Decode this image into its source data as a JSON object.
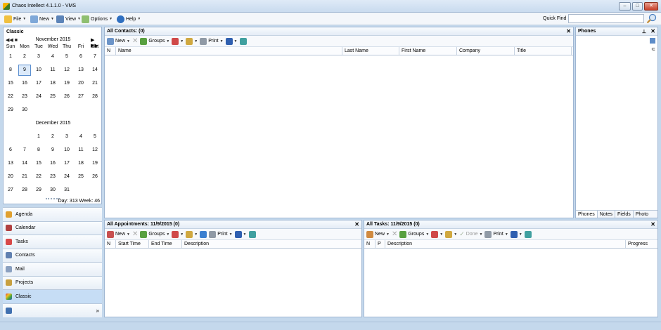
{
  "app_title": "Chaos Intellect 4.1.1.0 - VMS",
  "menu": {
    "file": "File",
    "new": "New",
    "view": "View",
    "options": "Options",
    "help": "Help"
  },
  "quick_find": "Quick Find",
  "calendar": {
    "title": "Classic",
    "weekdays": [
      "Sun",
      "Mon",
      "Tue",
      "Wed",
      "Thu",
      "Fri",
      "Sat"
    ],
    "month1": "November 2015",
    "month1_weeks": [
      [
        "1",
        "2",
        "3",
        "4",
        "5",
        "6",
        "7"
      ],
      [
        "8",
        "9",
        "10",
        "11",
        "12",
        "13",
        "14"
      ],
      [
        "15",
        "16",
        "17",
        "18",
        "19",
        "20",
        "21"
      ],
      [
        "22",
        "23",
        "24",
        "25",
        "26",
        "27",
        "28"
      ],
      [
        "29",
        "30",
        "",
        "",
        "",
        "",
        ""
      ]
    ],
    "month2": "December 2015",
    "month2_weeks": [
      [
        "",
        "",
        "1",
        "2",
        "3",
        "4",
        "5"
      ],
      [
        "6",
        "7",
        "8",
        "9",
        "10",
        "11",
        "12"
      ],
      [
        "13",
        "14",
        "15",
        "16",
        "17",
        "18",
        "19"
      ],
      [
        "20",
        "21",
        "22",
        "23",
        "24",
        "25",
        "26"
      ],
      [
        "27",
        "28",
        "29",
        "30",
        "31",
        "",
        ""
      ]
    ],
    "selected_day": "9",
    "day_info": "Day: 313  Week: 46"
  },
  "nav": [
    "Agenda",
    "Calendar",
    "Tasks",
    "Contacts",
    "Mail",
    "Projects",
    "Classic"
  ],
  "contacts": {
    "title": "All Contacts: (0)",
    "columns": [
      "N",
      "Name",
      "Last Name",
      "First Name",
      "Company",
      "Title"
    ]
  },
  "phones": {
    "title": "Phones",
    "tabs": [
      "Phones",
      "Notes",
      "Fields",
      "Photo"
    ]
  },
  "appointments": {
    "title": "All Appointments: 11/9/2015  (0)",
    "columns": [
      "N",
      "Start Time",
      "End Time",
      "Description"
    ]
  },
  "tasks": {
    "title": "All Tasks: 11/9/2015  (0)",
    "columns": [
      "N",
      "P",
      "Description",
      "Progress"
    ]
  },
  "toolbar": {
    "new": "New",
    "groups": "Groups",
    "print": "Print",
    "done": "Done"
  }
}
